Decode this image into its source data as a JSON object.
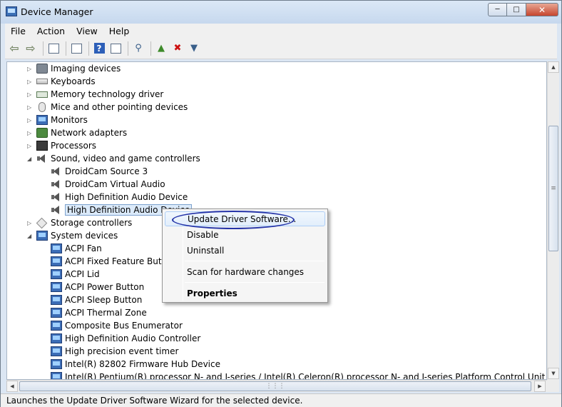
{
  "window": {
    "title": "Device Manager"
  },
  "menu": [
    "File",
    "Action",
    "View",
    "Help"
  ],
  "tree": {
    "items": [
      {
        "label": "Imaging devices",
        "level": 0,
        "expanded": false,
        "icon": "camera-icon"
      },
      {
        "label": "Keyboards",
        "level": 0,
        "expanded": false,
        "icon": "keyboard-icon"
      },
      {
        "label": "Memory technology driver",
        "level": 0,
        "expanded": false,
        "icon": "memory-icon"
      },
      {
        "label": "Mice and other pointing devices",
        "level": 0,
        "expanded": false,
        "icon": "mouse-icon"
      },
      {
        "label": "Monitors",
        "level": 0,
        "expanded": false,
        "icon": "monitor-icon"
      },
      {
        "label": "Network adapters",
        "level": 0,
        "expanded": false,
        "icon": "network-icon"
      },
      {
        "label": "Processors",
        "level": 0,
        "expanded": false,
        "icon": "processor-icon"
      },
      {
        "label": "Sound, video and game controllers",
        "level": 0,
        "expanded": true,
        "icon": "speaker-icon"
      },
      {
        "label": "DroidCam Source 3",
        "level": 1,
        "icon": "speaker-icon"
      },
      {
        "label": "DroidCam Virtual Audio",
        "level": 1,
        "icon": "speaker-icon"
      },
      {
        "label": "High Definition Audio Device",
        "level": 1,
        "icon": "speaker-icon"
      },
      {
        "label": "High Definition Audio Device",
        "level": 1,
        "icon": "speaker-icon",
        "selected": true
      },
      {
        "label": "Storage controllers",
        "level": 0,
        "expanded": false,
        "icon": "storage-icon"
      },
      {
        "label": "System devices",
        "level": 0,
        "expanded": true,
        "icon": "system-icon"
      },
      {
        "label": "ACPI Fan",
        "level": 1,
        "icon": "system-device-icon"
      },
      {
        "label": "ACPI Fixed Feature Button",
        "level": 1,
        "icon": "system-device-icon"
      },
      {
        "label": "ACPI Lid",
        "level": 1,
        "icon": "system-device-icon"
      },
      {
        "label": "ACPI Power Button",
        "level": 1,
        "icon": "system-device-icon"
      },
      {
        "label": "ACPI Sleep Button",
        "level": 1,
        "icon": "system-device-icon"
      },
      {
        "label": "ACPI Thermal Zone",
        "level": 1,
        "icon": "system-device-icon"
      },
      {
        "label": "Composite Bus Enumerator",
        "level": 1,
        "icon": "system-device-icon"
      },
      {
        "label": "High Definition Audio Controller",
        "level": 1,
        "icon": "system-device-icon"
      },
      {
        "label": "High precision event timer",
        "level": 1,
        "icon": "system-device-icon"
      },
      {
        "label": "Intel(R) 82802 Firmware Hub Device",
        "level": 1,
        "icon": "system-device-icon"
      },
      {
        "label": "Intel(R) Pentium(R) processor N- and J-series / Intel(R) Celeron(R) processor N- and J-series Platform Control Unit - SMBus Port -",
        "level": 1,
        "icon": "system-device-icon"
      }
    ]
  },
  "context_menu": {
    "items": [
      {
        "label": "Update Driver Software...",
        "highlighted": true
      },
      {
        "label": "Disable"
      },
      {
        "label": "Uninstall"
      },
      {
        "label": "Scan for hardware changes"
      },
      {
        "label": "Properties",
        "bold": true
      }
    ]
  },
  "status": "Launches the Update Driver Software Wizard for the selected device.",
  "colors": {
    "highlight_circle": "#2433a8",
    "selection": "#dbeafa"
  }
}
